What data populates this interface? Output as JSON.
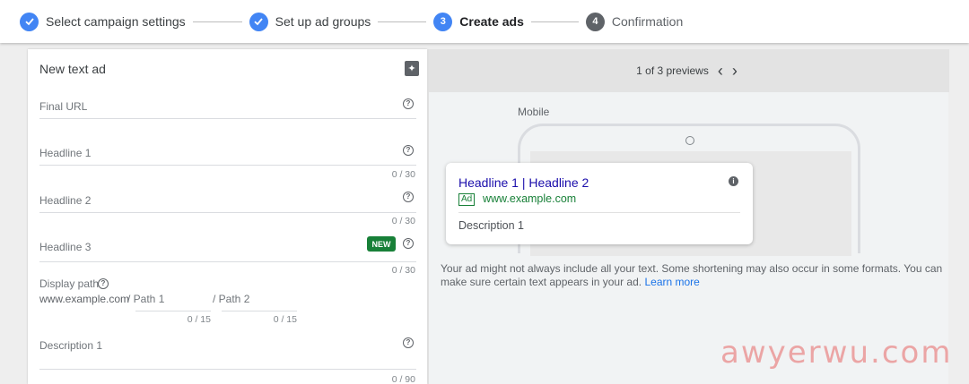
{
  "stepper": {
    "steps": [
      {
        "num": "",
        "label": "Select campaign settings",
        "state": "done"
      },
      {
        "num": "",
        "label": "Set up ad groups",
        "state": "done"
      },
      {
        "num": "3",
        "label": "Create ads",
        "state": "active"
      },
      {
        "num": "4",
        "label": "Confirmation",
        "state": "pending"
      }
    ]
  },
  "form": {
    "title": "New text ad",
    "final_url": {
      "label": "Final URL"
    },
    "headline1": {
      "label": "Headline 1",
      "counter": "0 / 30"
    },
    "headline2": {
      "label": "Headline 2",
      "counter": "0 / 30"
    },
    "headline3": {
      "label": "Headline 3",
      "counter": "0 / 30",
      "badge": "NEW"
    },
    "display_path": {
      "label": "Display path",
      "domain": "www.example.com",
      "path1": "/ Path 1",
      "path2": "/ Path 2",
      "path1_counter": "0 / 15",
      "path2_counter": "0 / 15"
    },
    "description1": {
      "label": "Description 1",
      "counter": "0 / 90"
    }
  },
  "preview": {
    "count_text": "1 of 3 previews",
    "device_label": "Mobile",
    "ad": {
      "headline": "Headline 1 | Headline 2",
      "badge": "Ad",
      "url": "www.example.com",
      "description": "Description 1"
    },
    "note": "Your ad might not always include all your text. Some shortening may also occur in some formats. You can make sure certain text appears in your ad.",
    "learn_more": "Learn more"
  },
  "watermark": "awyerwu.com",
  "colors": {
    "accent": "#4285f4",
    "link": "#1a0dab",
    "green": "#188038"
  }
}
